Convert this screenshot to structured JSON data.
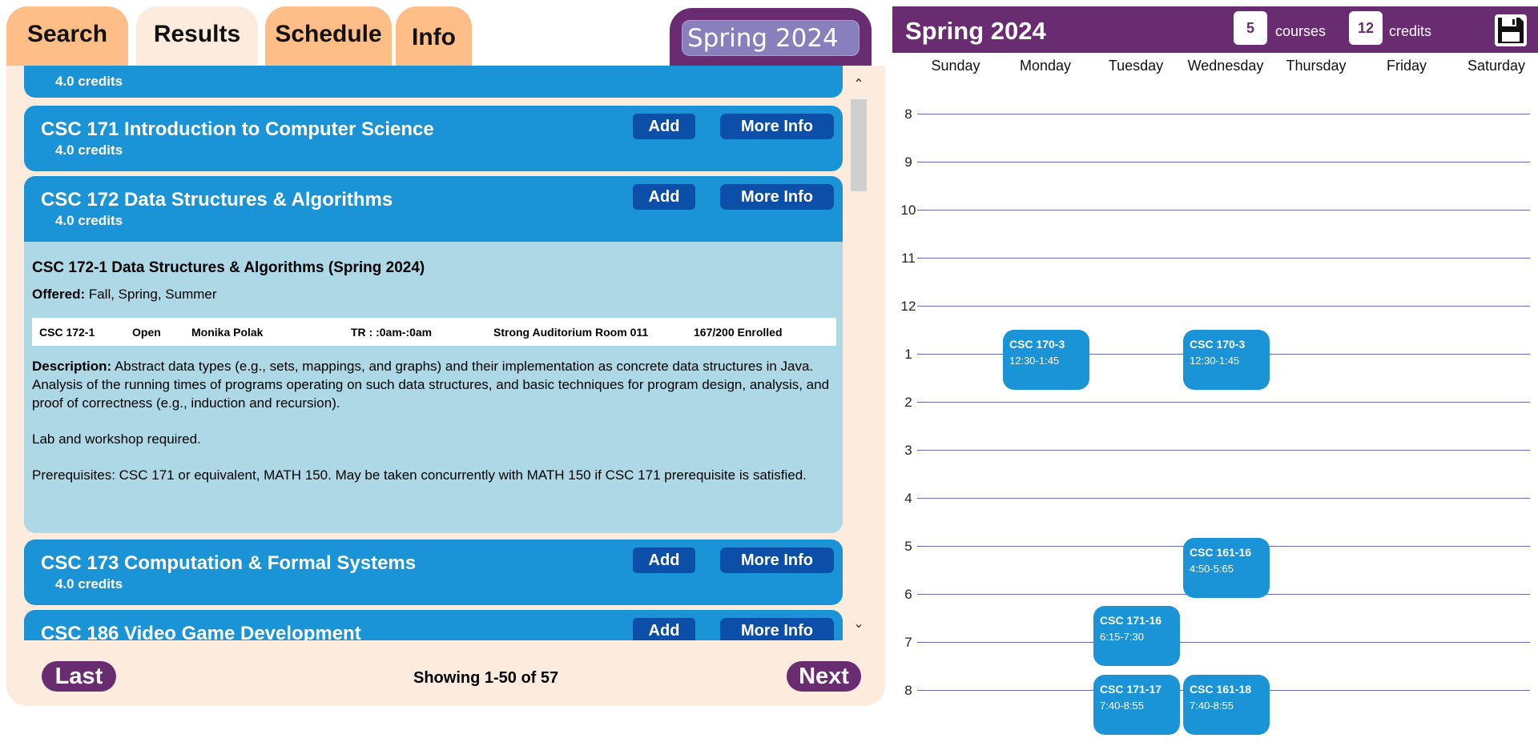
{
  "tabs": {
    "search": "Search",
    "results": "Results",
    "schedule": "Schedule",
    "info": "Info"
  },
  "term_selector": "Spring 2024",
  "results": {
    "top_partial_credits": "4.0 credits",
    "courses": [
      {
        "title": "CSC 171 Introduction to Computer Science",
        "credits": "4.0 credits",
        "add": "Add",
        "more": "More Info"
      },
      {
        "title": "CSC 172 Data Structures & Algorithms",
        "credits": "4.0 credits",
        "add": "Add",
        "more": "More Info"
      },
      {
        "title": "CSC 173 Computation & Formal Systems",
        "credits": "4.0 credits",
        "add": "Add",
        "more": "More Info"
      },
      {
        "title": "CSC 186 Video Game Development",
        "credits": "",
        "add": "Add",
        "more": "More Info"
      }
    ],
    "details": {
      "title": "CSC 172-1 Data Structures & Algorithms (Spring 2024)",
      "offered_label": "Offered:",
      "offered_value": " Fall, Spring, Summer",
      "section": {
        "id": "CSC 172-1",
        "status": "Open",
        "instructor": "Monika Polak",
        "time": "TR : :0am-:0am",
        "location": "Strong Auditorium Room 011",
        "enrolled": "167/200 Enrolled"
      },
      "description_label": "Description:",
      "description": " Abstract data types (e.g., sets, mappings, and graphs) and their implementation as concrete data structures in Java. Analysis of the running times of programs operating on such data structures, and basic techniques for program design, analysis, and proof of correctness (e.g., induction and recursion).",
      "lab": "Lab and workshop required.",
      "prereq": "Prerequisites: CSC 171 or equivalent, MATH 150. May be taken concurrently with MATH 150 if CSC 171 prerequisite is satisfied."
    },
    "pagination": {
      "prev": "Last",
      "next": "Next",
      "showing": "Showing 1-50 of 57"
    },
    "icons": [
      "chevron-up-icon",
      "chevron-down-icon"
    ]
  },
  "schedule": {
    "title": "Spring 2024",
    "courses_count": "5",
    "courses_label": "courses",
    "credits_count": "12",
    "credits_label": "credits",
    "save_icon": "floppy-disk-icon",
    "days": [
      "Sunday",
      "Monday",
      "Tuesday",
      "Wednesday",
      "Thursday",
      "Friday",
      "Saturday"
    ],
    "hours": [
      "8",
      "9",
      "10",
      "11",
      "12",
      "1",
      "2",
      "3",
      "4",
      "5",
      "6",
      "7",
      "8"
    ],
    "events": [
      {
        "course": "CSC 170-3",
        "time": "12:30-1:45"
      },
      {
        "course": "CSC 170-3",
        "time": "12:30-1:45"
      },
      {
        "course": "CSC 161-16",
        "time": "4:50-5:65"
      },
      {
        "course": "CSC 171-16",
        "time": "6:15-7:30"
      },
      {
        "course": "CSC 171-17",
        "time": "7:40-8:55"
      },
      {
        "course": "CSC 161-18",
        "time": "7:40-8:55"
      }
    ]
  }
}
